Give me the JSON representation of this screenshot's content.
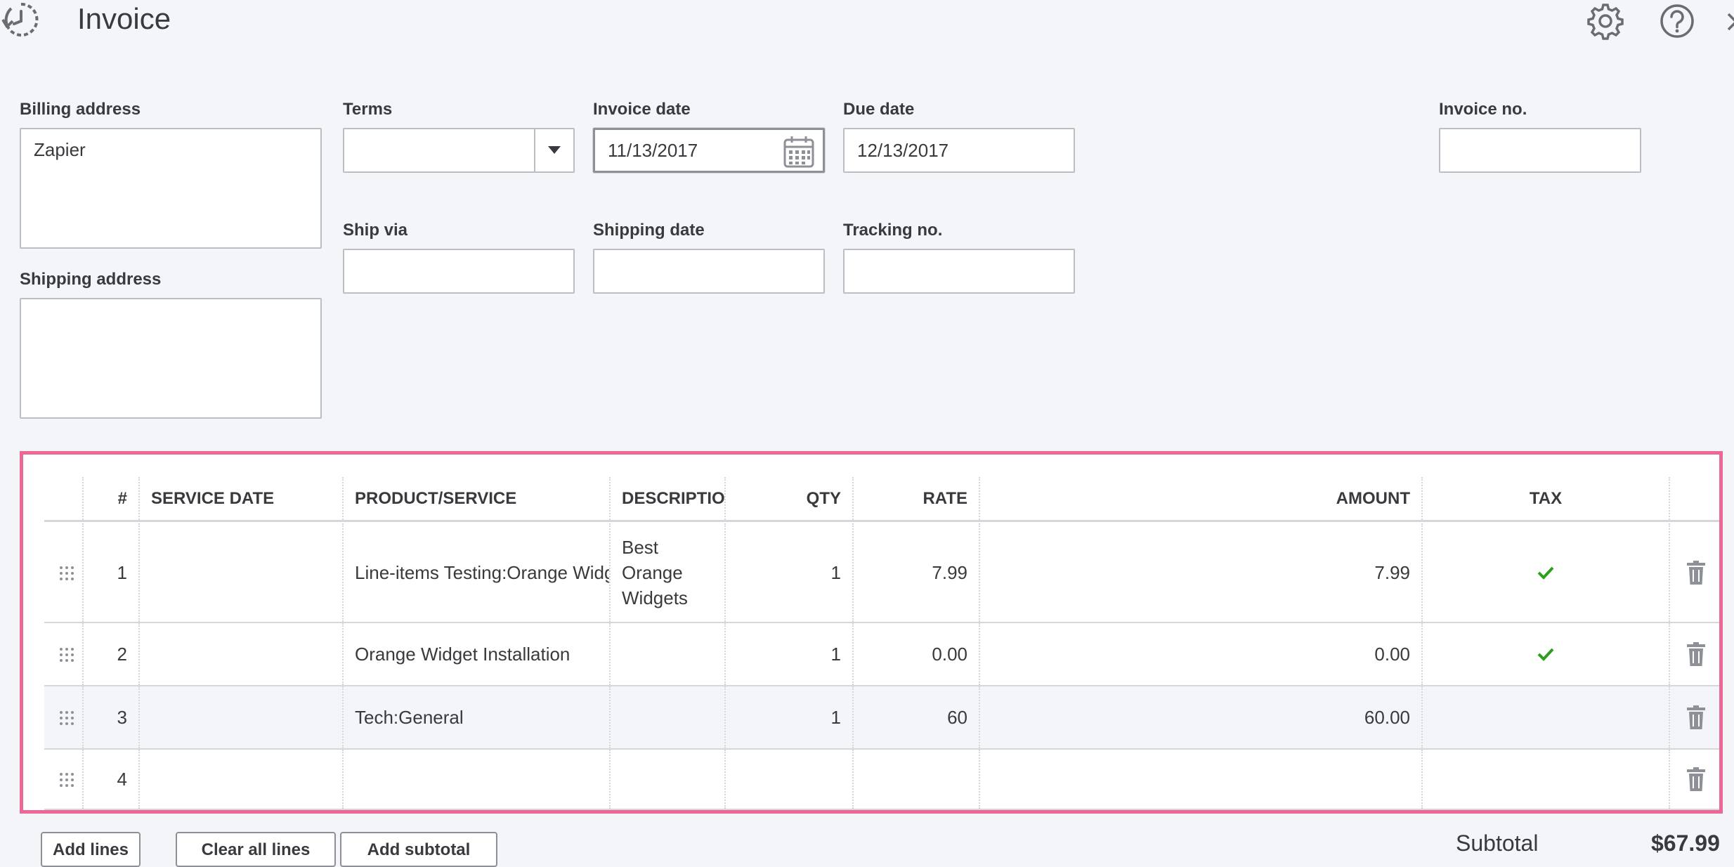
{
  "header": {
    "title": "Invoice",
    "icons": [
      "recent-transactions-icon",
      "gear-icon",
      "help-icon",
      "close-icon"
    ]
  },
  "form": {
    "billing_address_label": "Billing address",
    "billing_address_value": "Zapier",
    "shipping_address_label": "Shipping address",
    "shipping_address_value": "",
    "terms_label": "Terms",
    "terms_value": "",
    "invoice_date_label": "Invoice date",
    "invoice_date_value": "11/13/2017",
    "due_date_label": "Due date",
    "due_date_value": "12/13/2017",
    "invoice_no_label": "Invoice no.",
    "invoice_no_value": "",
    "ship_via_label": "Ship via",
    "ship_via_value": "",
    "shipping_date_label": "Shipping date",
    "shipping_date_value": "",
    "tracking_no_label": "Tracking no.",
    "tracking_no_value": ""
  },
  "table": {
    "columns": [
      "#",
      "SERVICE DATE",
      "PRODUCT/SERVICE",
      "DESCRIPTIO",
      "QTY",
      "RATE",
      "AMOUNT",
      "TAX"
    ],
    "rows": [
      {
        "num": "1",
        "service_date": "",
        "product": "Line-items Testing:Orange Widgets",
        "description": "Best Orange Widgets",
        "qty": "1",
        "rate": "7.99",
        "amount": "7.99",
        "tax": true
      },
      {
        "num": "2",
        "service_date": "",
        "product": "Orange Widget Installation",
        "description": "",
        "qty": "1",
        "rate": "0.00",
        "amount": "0.00",
        "tax": true
      },
      {
        "num": "3",
        "service_date": "",
        "product": "Tech:General",
        "description": "",
        "qty": "1",
        "rate": "60",
        "amount": "60.00",
        "tax": false
      },
      {
        "num": "4",
        "service_date": "",
        "product": "",
        "description": "",
        "qty": "",
        "rate": "",
        "amount": "",
        "tax": false
      }
    ]
  },
  "actions": {
    "add_lines": "Add lines",
    "clear_all_lines": "Clear all lines",
    "add_subtotal": "Add subtotal"
  },
  "totals": {
    "subtotal_label": "Subtotal",
    "subtotal_value": "$67.99"
  },
  "colors": {
    "highlight": "#ed6896",
    "check": "#2ca01c",
    "text": "#393a3d"
  }
}
